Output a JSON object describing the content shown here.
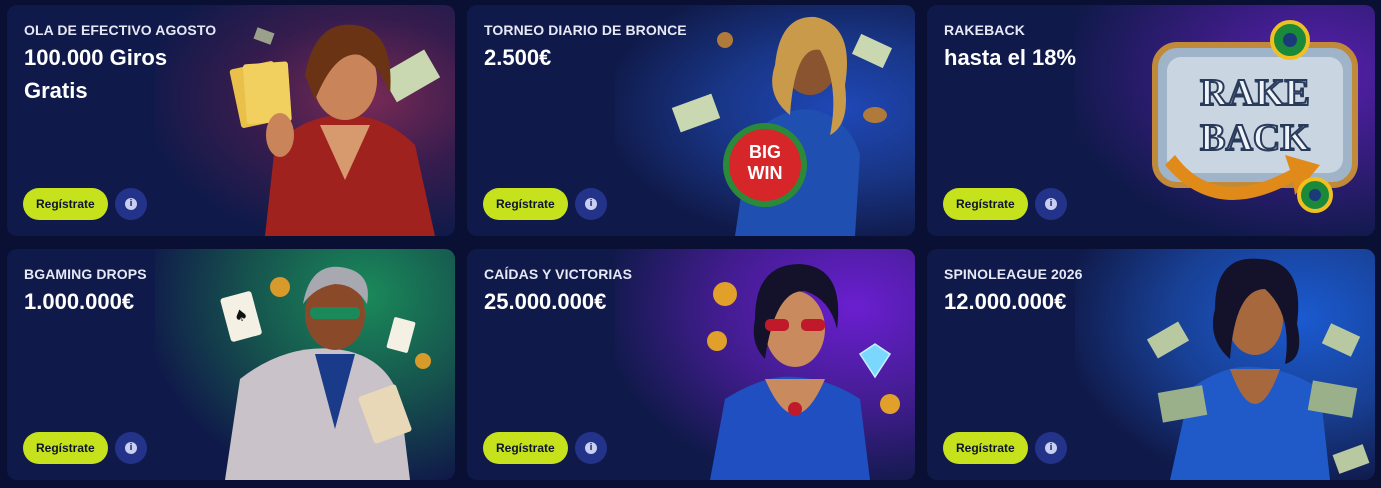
{
  "cards": [
    {
      "kicker": "OLA DE EFECTIVO AGOSTO",
      "title": "100.000 Giros Gratis",
      "button": "Regístrate",
      "info": "i",
      "accent": "#8a2a5a",
      "art": "woman-red-suit-cards-illustration"
    },
    {
      "kicker": "TORNEO DIARIO DE BRONCE",
      "title": "2.500€",
      "button": "Regístrate",
      "info": "i",
      "accent": "#1f44a8",
      "art": "woman-blue-suit-watermelon-illustration",
      "art_text": "BIG WIN"
    },
    {
      "kicker": "RAKEBACK",
      "title": "hasta el 18%",
      "button": "Regístrate",
      "info": "i",
      "accent": "#5a1fa8",
      "art": "rakeback-chest-illustration",
      "art_text": "RAKE BACK"
    },
    {
      "kicker": "BGAMING DROPS",
      "title": "1.000.000€",
      "button": "Regístrate",
      "info": "i",
      "accent": "#1a8a5a",
      "art": "man-silver-suit-cards-illustration"
    },
    {
      "kicker": "CAÍDAS Y VICTORIAS",
      "title": "25.000.000€",
      "button": "Regístrate",
      "info": "i",
      "accent": "#6a1fc0",
      "art": "woman-blue-dress-diamond-illustration"
    },
    {
      "kicker": "SPINOLEAGUE 2026",
      "title": "12.000.000€",
      "button": "Regístrate",
      "info": "i",
      "accent": "#1a5ac0",
      "art": "woman-blue-dress-cash-illustration"
    }
  ]
}
